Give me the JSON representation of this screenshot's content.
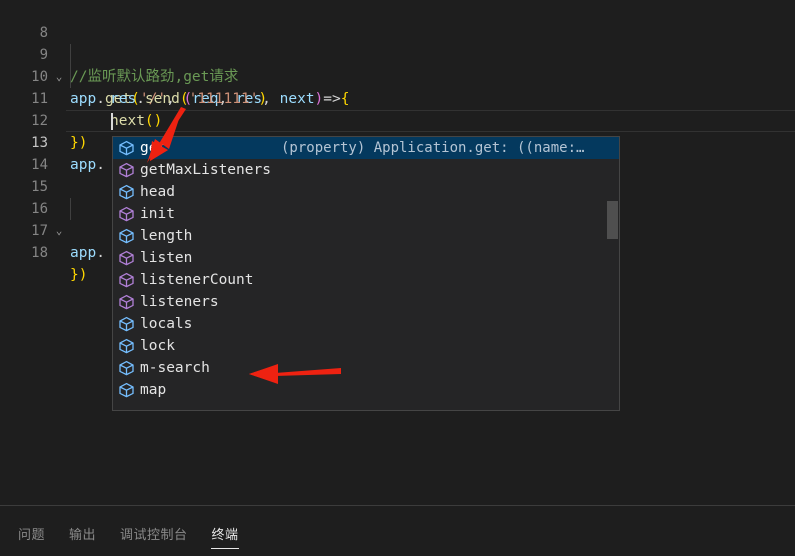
{
  "editor": {
    "lines": [
      {
        "number": "8",
        "fold": "",
        "indent_guides": []
      },
      {
        "number": "9",
        "fold": "⌄",
        "indent_guides": []
      },
      {
        "number": "10",
        "fold": "",
        "indent_guides": [
          70
        ]
      },
      {
        "number": "11",
        "fold": "",
        "indent_guides": [
          70
        ]
      },
      {
        "number": "12",
        "fold": "",
        "indent_guides": []
      },
      {
        "number": "13",
        "fold": "",
        "indent_guides": []
      },
      {
        "number": "14",
        "fold": "",
        "indent_guides": []
      },
      {
        "number": "15",
        "fold": "",
        "indent_guides": []
      },
      {
        "number": "16",
        "fold": "⌄",
        "indent_guides": []
      },
      {
        "number": "17",
        "fold": "",
        "indent_guides": [
          70
        ]
      },
      {
        "number": "18",
        "fold": "",
        "indent_guides": []
      }
    ],
    "line_8_comment": "//监听默认路劲,get请求",
    "line_9": {
      "obj": "app",
      "dot": ".",
      "fn": "get",
      "paren_open": "(",
      "str": "'/'",
      "comma": ", ",
      "paren2": "(",
      "p1": "req",
      "c1": ", ",
      "p2": "res",
      "c2": ", ",
      "p3": "next",
      "paren2_close": ")",
      "arrow": "=>",
      "brace": "{"
    },
    "line_10": {
      "obj": "res",
      "dot": ".",
      "fn": "send",
      "paren_open": "(",
      "str": "'111111'",
      "paren_close": ")"
    },
    "line_11": {
      "fn": "next",
      "paren_open": "(",
      "paren_close": ")"
    },
    "line_12": {
      "brace_close": "}",
      "paren_close": ")"
    },
    "line_13": {
      "obj": "app",
      "dot": "."
    },
    "line_16": {
      "obj": "app",
      "dot": "."
    },
    "line_18": {
      "brace_close": "}",
      "paren_close": ")"
    },
    "active_line_number": "13"
  },
  "suggest": {
    "detail": "(property) Application.get: ((name:…",
    "items": [
      {
        "label": "get",
        "icon": "property-cube-icon",
        "icon_kind": "property",
        "selected": true
      },
      {
        "label": "getMaxListeners",
        "icon": "method-cube-icon",
        "icon_kind": "method",
        "selected": false
      },
      {
        "label": "head",
        "icon": "property-cube-icon",
        "icon_kind": "property",
        "selected": false
      },
      {
        "label": "init",
        "icon": "method-cube-icon",
        "icon_kind": "method",
        "selected": false
      },
      {
        "label": "length",
        "icon": "property-cube-icon",
        "icon_kind": "property",
        "selected": false
      },
      {
        "label": "listen",
        "icon": "method-cube-icon",
        "icon_kind": "method",
        "selected": false
      },
      {
        "label": "listenerCount",
        "icon": "method-cube-icon",
        "icon_kind": "method",
        "selected": false
      },
      {
        "label": "listeners",
        "icon": "method-cube-icon",
        "icon_kind": "method",
        "selected": false
      },
      {
        "label": "locals",
        "icon": "property-cube-icon",
        "icon_kind": "property",
        "selected": false
      },
      {
        "label": "lock",
        "icon": "property-cube-icon",
        "icon_kind": "property",
        "selected": false
      },
      {
        "label": "m-search",
        "icon": "property-cube-icon",
        "icon_kind": "property",
        "selected": false
      },
      {
        "label": "map",
        "icon": "property-cube-icon",
        "icon_kind": "property",
        "selected": false
      }
    ]
  },
  "panel": {
    "tabs": [
      {
        "label": "问题",
        "active": false
      },
      {
        "label": "输出",
        "active": false
      },
      {
        "label": "调试控制台",
        "active": false
      },
      {
        "label": "终端",
        "active": true
      }
    ]
  },
  "annotations": {
    "arrow_1_target": "get",
    "arrow_2_target": "m-search",
    "arrow_color": "#ee2211"
  },
  "colors": {
    "editor_background": "#1e1e1e",
    "suggest_background": "#252526",
    "suggest_selected": "#04395e",
    "suggest_border": "#454545",
    "comment": "#6a9955",
    "variable": "#9cdcfe",
    "function": "#dcdcaa",
    "string": "#ce9178",
    "line_number": "#858585",
    "active_line_number": "#c6c6c6"
  }
}
